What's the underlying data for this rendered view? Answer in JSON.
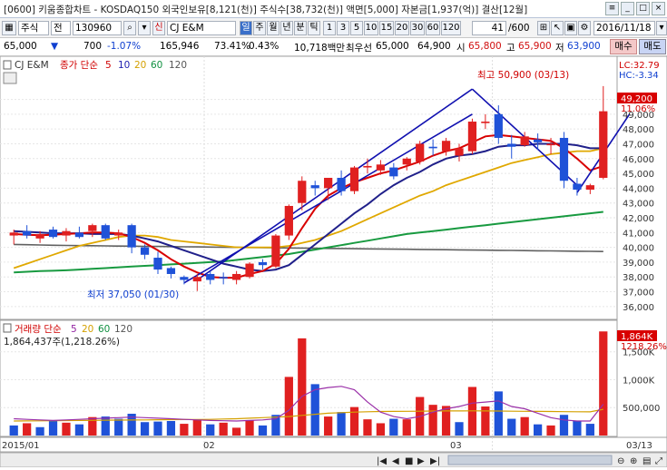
{
  "titlebar": {
    "title": "[0600] 키움종합차트 - KOSDAQ150 외국인보유[8,121(천)] 주식수[38,732(천)] 액면[5,000] 자본금[1,937(억)] 결산[12월]"
  },
  "toolbar": {
    "market": "주식",
    "market_sel": "전",
    "code": "130960",
    "credit": "신",
    "name": "CJ E&M",
    "periods": [
      "일",
      "주",
      "월",
      "년",
      "분",
      "틱"
    ],
    "minutes": [
      "1",
      "3",
      "5",
      "10",
      "15",
      "20",
      "30",
      "60",
      "120"
    ],
    "page": "41",
    "page_total": "/600",
    "date": "2016/11/18"
  },
  "quote": {
    "price": "65,000",
    "change": "700",
    "change_pct": "-1.07%",
    "volume": "165,946",
    "vol_ratio": "73.41%",
    "turnover": "0.43%",
    "amount": "10,718백만",
    "priority_ask_label": "최우선",
    "ask": "65,000",
    "bid": "64,900",
    "open_label": "시",
    "open": "65,800",
    "high_label": "고",
    "high": "65,900",
    "low_label": "저",
    "low": "63,900",
    "buy_label": "매수",
    "sell_label": "매도"
  },
  "price_panel": {
    "legend_name": "CJ E&M",
    "legend_label": "종가 단순",
    "ma_periods": [
      "5",
      "10",
      "20",
      "60",
      "120"
    ],
    "lc_label": "LC:32.79",
    "hc_label": "HC:-3.34",
    "max_label": "최고 50,900 (03/13)",
    "min_label": "최저 37,050 (01/30)",
    "last_price": "49,200",
    "last_pct": "11.06%",
    "y_ticks": [
      "50,000",
      "49,000",
      "48,000",
      "47,000",
      "46,000",
      "45,000",
      "44,000",
      "43,000",
      "42,000",
      "41,000",
      "40,000",
      "39,000",
      "38,000",
      "37,000",
      "36,000"
    ]
  },
  "volume_panel": {
    "legend_label": "거래량 단순",
    "ma_periods": [
      "5",
      "20",
      "60",
      "120"
    ],
    "info": "1,864,437주(1,218.26%)",
    "last_vol": "1,864K",
    "last_pct": "1218.26%",
    "y_ticks": [
      "1,500K",
      "1,000K",
      "500,000"
    ]
  },
  "x_axis": {
    "labels": [
      "2015/01",
      "02",
      "03"
    ],
    "right_label": "03/13"
  },
  "chart_data": {
    "type": "candlestick",
    "y_range": [
      35500,
      51200
    ],
    "vol_range": [
      0,
      1950000
    ],
    "candles": [
      {
        "o": 40800,
        "h": 41200,
        "l": 40200,
        "c": 41000
      },
      {
        "o": 41100,
        "h": 41500,
        "l": 40600,
        "c": 40800
      },
      {
        "o": 40600,
        "h": 41100,
        "l": 40300,
        "c": 40900
      },
      {
        "o": 41200,
        "h": 41400,
        "l": 40600,
        "c": 40700
      },
      {
        "o": 40800,
        "h": 41300,
        "l": 40400,
        "c": 41100
      },
      {
        "o": 41000,
        "h": 41400,
        "l": 40600,
        "c": 40700
      },
      {
        "o": 41100,
        "h": 41600,
        "l": 40700,
        "c": 41500
      },
      {
        "o": 41500,
        "h": 41600,
        "l": 40500,
        "c": 40600
      },
      {
        "o": 40800,
        "h": 41200,
        "l": 40500,
        "c": 41000
      },
      {
        "o": 41500,
        "h": 41600,
        "l": 39600,
        "c": 40000
      },
      {
        "o": 40000,
        "h": 40200,
        "l": 39200,
        "c": 39500
      },
      {
        "o": 39300,
        "h": 39700,
        "l": 38200,
        "c": 38500
      },
      {
        "o": 38600,
        "h": 38700,
        "l": 37900,
        "c": 38200
      },
      {
        "o": 38000,
        "h": 38100,
        "l": 37500,
        "c": 37800
      },
      {
        "o": 37700,
        "h": 38200,
        "l": 37050,
        "c": 38000
      },
      {
        "o": 38200,
        "h": 38400,
        "l": 37500,
        "c": 37800
      },
      {
        "o": 38000,
        "h": 38300,
        "l": 37500,
        "c": 37900
      },
      {
        "o": 37800,
        "h": 38400,
        "l": 37500,
        "c": 38200
      },
      {
        "o": 38000,
        "h": 39000,
        "l": 37900,
        "c": 38900
      },
      {
        "o": 39000,
        "h": 39200,
        "l": 38500,
        "c": 38800
      },
      {
        "o": 38700,
        "h": 40900,
        "l": 38600,
        "c": 40800
      },
      {
        "o": 40800,
        "h": 42900,
        "l": 40500,
        "c": 42800
      },
      {
        "o": 43000,
        "h": 44800,
        "l": 42500,
        "c": 44500
      },
      {
        "o": 44200,
        "h": 44500,
        "l": 43500,
        "c": 44000
      },
      {
        "o": 44000,
        "h": 44700,
        "l": 43200,
        "c": 44700
      },
      {
        "o": 44700,
        "h": 45200,
        "l": 43500,
        "c": 43800
      },
      {
        "o": 43800,
        "h": 45500,
        "l": 43600,
        "c": 45400
      },
      {
        "o": 45400,
        "h": 46000,
        "l": 45000,
        "c": 45500
      },
      {
        "o": 45200,
        "h": 45900,
        "l": 44900,
        "c": 45600
      },
      {
        "o": 45400,
        "h": 45700,
        "l": 44600,
        "c": 44800
      },
      {
        "o": 45600,
        "h": 46100,
        "l": 45200,
        "c": 46000
      },
      {
        "o": 45800,
        "h": 47200,
        "l": 45600,
        "c": 47000
      },
      {
        "o": 46800,
        "h": 47300,
        "l": 46200,
        "c": 46700
      },
      {
        "o": 46500,
        "h": 47400,
        "l": 46200,
        "c": 47200
      },
      {
        "o": 46200,
        "h": 47000,
        "l": 45800,
        "c": 46700
      },
      {
        "o": 46500,
        "h": 48700,
        "l": 46300,
        "c": 48500
      },
      {
        "o": 48400,
        "h": 49000,
        "l": 48000,
        "c": 48500
      },
      {
        "o": 49000,
        "h": 49600,
        "l": 47000,
        "c": 47400
      },
      {
        "o": 47000,
        "h": 47600,
        "l": 46000,
        "c": 46800
      },
      {
        "o": 46900,
        "h": 47800,
        "l": 46800,
        "c": 47500
      },
      {
        "o": 47300,
        "h": 47700,
        "l": 46600,
        "c": 47100
      },
      {
        "o": 46900,
        "h": 47400,
        "l": 46300,
        "c": 47000
      },
      {
        "o": 47400,
        "h": 47800,
        "l": 44000,
        "c": 44500
      },
      {
        "o": 44300,
        "h": 44700,
        "l": 43500,
        "c": 43900
      },
      {
        "o": 43900,
        "h": 44300,
        "l": 43600,
        "c": 44200
      },
      {
        "o": 44700,
        "h": 50900,
        "l": 44600,
        "c": 49200
      }
    ],
    "volumes": [
      {
        "v": 180000,
        "up": false
      },
      {
        "v": 220000,
        "up": true
      },
      {
        "v": 150000,
        "up": false
      },
      {
        "v": 260000,
        "up": false
      },
      {
        "v": 230000,
        "up": true
      },
      {
        "v": 200000,
        "up": false
      },
      {
        "v": 330000,
        "up": true
      },
      {
        "v": 340000,
        "up": false
      },
      {
        "v": 300000,
        "up": false
      },
      {
        "v": 390000,
        "up": false
      },
      {
        "v": 240000,
        "up": false
      },
      {
        "v": 250000,
        "up": false
      },
      {
        "v": 260000,
        "up": false
      },
      {
        "v": 210000,
        "up": true
      },
      {
        "v": 280000,
        "up": true
      },
      {
        "v": 200000,
        "up": false
      },
      {
        "v": 230000,
        "up": true
      },
      {
        "v": 140000,
        "up": true
      },
      {
        "v": 270000,
        "up": true
      },
      {
        "v": 180000,
        "up": false
      },
      {
        "v": 370000,
        "up": false
      },
      {
        "v": 1050000,
        "up": true
      },
      {
        "v": 1740000,
        "up": true
      },
      {
        "v": 920000,
        "up": false
      },
      {
        "v": 340000,
        "up": true
      },
      {
        "v": 420000,
        "up": false
      },
      {
        "v": 510000,
        "up": true
      },
      {
        "v": 290000,
        "up": true
      },
      {
        "v": 220000,
        "up": true
      },
      {
        "v": 300000,
        "up": false
      },
      {
        "v": 290000,
        "up": true
      },
      {
        "v": 690000,
        "up": true
      },
      {
        "v": 550000,
        "up": true
      },
      {
        "v": 530000,
        "up": true
      },
      {
        "v": 240000,
        "up": false
      },
      {
        "v": 870000,
        "up": true
      },
      {
        "v": 520000,
        "up": true
      },
      {
        "v": 790000,
        "up": false
      },
      {
        "v": 300000,
        "up": false
      },
      {
        "v": 330000,
        "up": true
      },
      {
        "v": 200000,
        "up": false
      },
      {
        "v": 180000,
        "up": true
      },
      {
        "v": 370000,
        "up": false
      },
      {
        "v": 260000,
        "up": false
      },
      {
        "v": 210000,
        "up": false
      },
      {
        "v": 1864437,
        "up": true
      }
    ],
    "ma5": [
      40900,
      40850,
      40820,
      40850,
      40900,
      40950,
      41000,
      41000,
      40950,
      40700,
      40300,
      39800,
      39200,
      38700,
      38300,
      38000,
      37950,
      37950,
      38200,
      38400,
      38900,
      39900,
      41300,
      42600,
      43500,
      44000,
      44400,
      44700,
      45000,
      45200,
      45500,
      45800,
      46200,
      46500,
      46700,
      47100,
      47500,
      47600,
      47500,
      47400,
      47300,
      47200,
      46700,
      46000,
      45200,
      45500
    ],
    "ma10": [
      41100,
      41050,
      41000,
      40950,
      40950,
      40950,
      40900,
      40900,
      40900,
      40800,
      40600,
      40400,
      40100,
      39800,
      39500,
      39200,
      38900,
      38700,
      38500,
      38400,
      38500,
      38800,
      39500,
      40200,
      40900,
      41600,
      42300,
      42900,
      43600,
      44200,
      44700,
      45100,
      45600,
      46000,
      46200,
      46300,
      46500,
      46800,
      46900,
      46900,
      47000,
      47000,
      47000,
      46900,
      46700,
      46700
    ],
    "ma20": [
      38600,
      38900,
      39200,
      39500,
      39800,
      40100,
      40300,
      40500,
      40700,
      40800,
      40800,
      40700,
      40500,
      40400,
      40300,
      40200,
      40100,
      40000,
      40000,
      40000,
      40000,
      40100,
      40300,
      40500,
      40800,
      41100,
      41500,
      41900,
      42300,
      42700,
      43100,
      43500,
      43800,
      44200,
      44500,
      44800,
      45100,
      45400,
      45700,
      45900,
      46100,
      46300,
      46400,
      46500,
      46500,
      46700
    ],
    "ma60": [
      38300,
      38350,
      38400,
      38420,
      38450,
      38500,
      38550,
      38600,
      38650,
      38700,
      38750,
      38800,
      38850,
      38900,
      38950,
      39000,
      39050,
      39150,
      39250,
      39350,
      39450,
      39550,
      39700,
      39850,
      40000,
      40150,
      40300,
      40450,
      40600,
      40750,
      40900,
      41000,
      41100,
      41200,
      41300,
      41400,
      41500,
      41600,
      41700,
      41800,
      41900,
      42000,
      42100,
      42200,
      42300,
      42400
    ],
    "ma120": [
      40200,
      40180,
      40160,
      40140,
      40130,
      40120,
      40110,
      40100,
      40090,
      40080,
      40070,
      40060,
      40050,
      40040,
      40030,
      40020,
      40010,
      40000,
      39990,
      39980,
      39970,
      39960,
      39950,
      39940,
      39930,
      39920,
      39910,
      39900,
      39890,
      39880,
      39870,
      39860,
      39850,
      39840,
      39830,
      39820,
      39810,
      39800,
      39790,
      39780,
      39770,
      39760,
      39750,
      39740,
      39730,
      39720
    ],
    "vma5": [
      300000,
      290000,
      280000,
      270000,
      280000,
      290000,
      300000,
      310000,
      320000,
      330000,
      320000,
      310000,
      300000,
      290000,
      280000,
      270000,
      265000,
      260000,
      270000,
      280000,
      300000,
      450000,
      700000,
      820000,
      860000,
      880000,
      820000,
      600000,
      420000,
      340000,
      300000,
      340000,
      420000,
      480000,
      520000,
      580000,
      600000,
      620000,
      520000,
      480000,
      400000,
      320000,
      280000,
      260000,
      260000,
      560000
    ],
    "vma20": [
      260000,
      262000,
      264000,
      266000,
      268000,
      270000,
      272000,
      274000,
      276000,
      278000,
      280000,
      282000,
      284000,
      286000,
      288000,
      290000,
      295000,
      300000,
      310000,
      320000,
      330000,
      340000,
      360000,
      380000,
      400000,
      410000,
      420000,
      425000,
      430000,
      432000,
      434000,
      436000,
      438000,
      440000,
      440000,
      442000,
      440000,
      438000,
      436000,
      434000,
      432000,
      430000,
      428000,
      426000,
      424000,
      470000
    ],
    "trend_lines": [
      {
        "from": [
          14,
          37800
        ],
        "to": [
          35,
          50700
        ]
      },
      {
        "from": [
          35,
          50700
        ],
        "to": [
          43,
          44200
        ]
      },
      {
        "from": [
          13,
          37600
        ],
        "to": [
          35,
          49000
        ]
      },
      {
        "from": [
          43,
          43700
        ],
        "to": [
          47,
          49000
        ]
      }
    ]
  }
}
